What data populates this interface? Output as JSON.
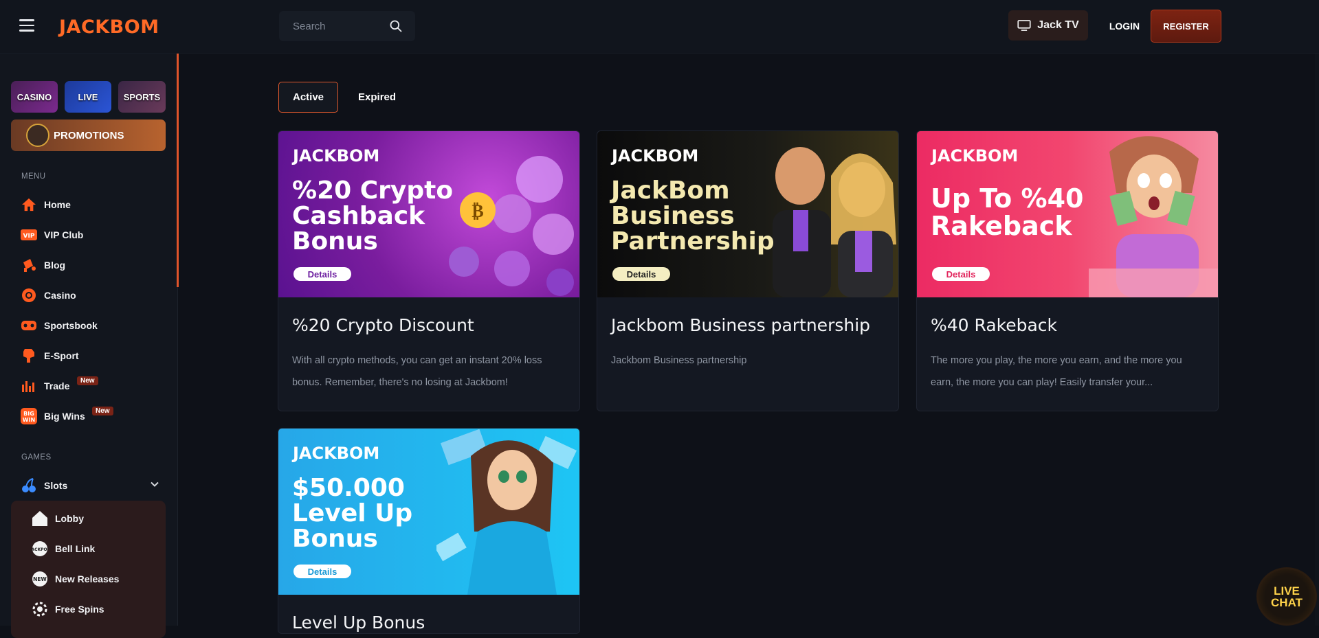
{
  "header": {
    "logo_text": "JACKBOM",
    "search_placeholder": "Search",
    "jacktv_label": "Jack TV",
    "login_label": "LOGIN",
    "register_label": "REGISTER"
  },
  "sidebar": {
    "categories": {
      "casino": "CASINO",
      "live": "LIVE",
      "sports": "SPORTS"
    },
    "promotions_label": "PROMOTIONS",
    "menu_heading": "MENU",
    "menu_items": [
      {
        "label": "Home",
        "icon": "home-icon"
      },
      {
        "label": "VIP Club",
        "icon": "vip-icon"
      },
      {
        "label": "Blog",
        "icon": "blog-icon"
      },
      {
        "label": "Casino",
        "icon": "casino-chip-icon"
      },
      {
        "label": "Sportsbook",
        "icon": "sportsbook-icon"
      },
      {
        "label": "E-Sport",
        "icon": "esport-icon"
      },
      {
        "label": "Trade",
        "icon": "trade-icon",
        "badge": "New"
      },
      {
        "label": "Big Wins",
        "icon": "big-wins-icon",
        "badge": "New"
      }
    ],
    "games_heading": "GAMES",
    "games_item": {
      "label": "Slots",
      "icon": "slots-cherry-icon"
    },
    "slots_sub": [
      {
        "label": "Lobby",
        "icon": "lobby-icon"
      },
      {
        "label": "Bell Link",
        "icon": "bell-link-icon"
      },
      {
        "label": "New Releases",
        "icon": "new-icon"
      },
      {
        "label": "Free Spins",
        "icon": "free-spins-icon"
      }
    ]
  },
  "tabs": {
    "active": "Active",
    "expired": "Expired"
  },
  "cards": [
    {
      "brand": "JACKBOM",
      "headline": "%20 Crypto\nCashback\nBonus",
      "details": "Details",
      "title": "%20 Crypto Discount",
      "description": "With all crypto methods, you can get an instant 20% loss bonus. Remember, there's no losing at Jackbom!"
    },
    {
      "brand": "JACKBOM",
      "headline": "JackBom\nBusiness\nPartnership",
      "details": "Details",
      "title": "Jackbom Business partnership",
      "description": "Jackbom Business partnership"
    },
    {
      "brand": "JACKBOM",
      "headline": "Up To %40\nRakeback",
      "details": "Details",
      "title": "%40 Rakeback",
      "description": "The more you play, the more you earn, and the more you earn, the more you can play! Easily transfer your..."
    },
    {
      "brand": "JACKBOM",
      "headline": "$50.000\nLevel Up\nBonus",
      "details": "Details",
      "title": "Level Up Bonus",
      "description": ""
    }
  ],
  "livechat": {
    "label": "LIVE CHAT"
  },
  "colors": {
    "accent": "#e35a2e",
    "bg": "#0e1118",
    "sidebar": "#12161e"
  }
}
